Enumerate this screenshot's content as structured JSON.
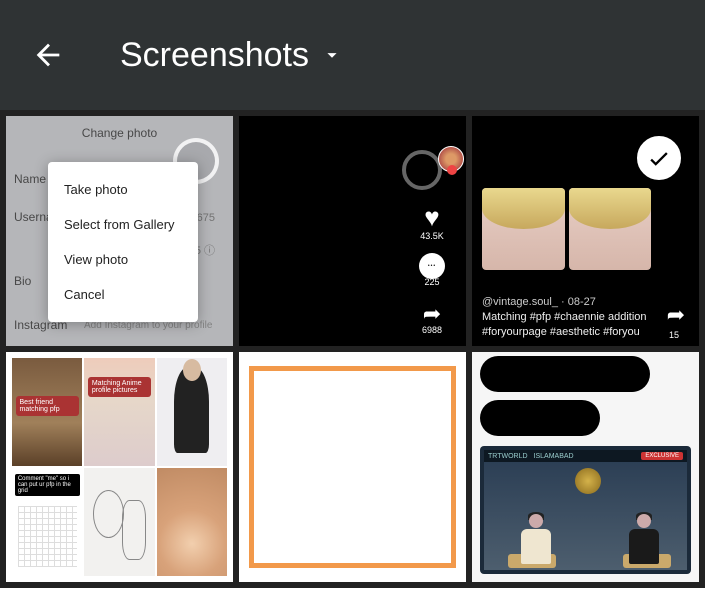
{
  "topbar": {
    "title": "Screenshots"
  },
  "thumbs": {
    "t1": {
      "header": "Change photo",
      "labels": {
        "name": "Name",
        "username": "Userna",
        "bio": "Bio",
        "instagram": "Instagram"
      },
      "values": {
        "v1": ",675",
        "v2": ",675 ⓘ"
      },
      "instagram_hint": "Add Instagram to your profile",
      "menu": {
        "m1": "Take photo",
        "m2": "Select from Gallery",
        "m3": "View photo",
        "m4": "Cancel"
      }
    },
    "t2": {
      "likes": "43.5K",
      "comments": "225",
      "shares": "6988"
    },
    "t3": {
      "user_line": "@vintage.soul_ · 08-27",
      "caption_line1": "Matching #pfp #chaennie addition",
      "caption_line2": "#foryourpage #aesthetic #foryou",
      "shares": "15"
    },
    "t4": {
      "cell1_banner": "Best friend matching pfp",
      "cell2_banner": "Matching Anime profile pictures",
      "cell4_banner": "Comment \"me\" so i can put ur pfp in the grid"
    },
    "t6": {
      "channel": "TRTWORLD",
      "location": "ISLAMABAD",
      "tag": "EXCLUSIVE"
    }
  }
}
